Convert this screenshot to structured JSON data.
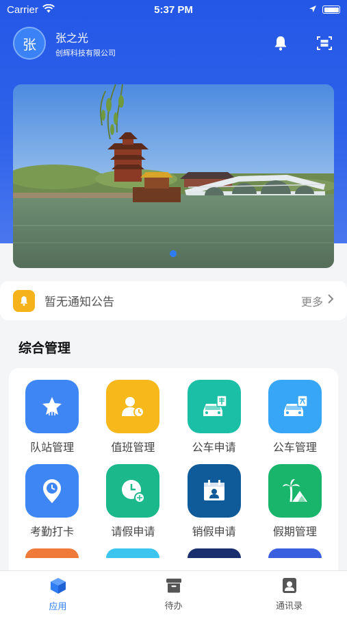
{
  "status": {
    "carrier": "Carrier",
    "time": "5:37 PM"
  },
  "user": {
    "avatar_text": "张",
    "name": "张之光",
    "company": "创辉科技有限公司"
  },
  "header_icons": [
    "bell-icon",
    "scan-icon"
  ],
  "banner": {
    "slide_count": 1,
    "active_slide": 1
  },
  "notice": {
    "text": "暂无通知公告",
    "more": "更多"
  },
  "section": {
    "title": "综合管理"
  },
  "grid": {
    "items": [
      {
        "label": "队站管理",
        "icon": "star-icon",
        "color": "#3f86f5"
      },
      {
        "label": "值班管理",
        "icon": "duty-person-icon",
        "color": "#f7b81b"
      },
      {
        "label": "公车申请",
        "icon": "car-apply-icon",
        "color": "#1bbfa6"
      },
      {
        "label": "公车管理",
        "icon": "car-manage-icon",
        "color": "#38a6f6"
      },
      {
        "label": "考勤打卡",
        "icon": "location-clock-icon",
        "color": "#3f86f5"
      },
      {
        "label": "请假申请",
        "icon": "clock-leave-icon",
        "color": "#1bb88c"
      },
      {
        "label": "销假申请",
        "icon": "calendar-person-icon",
        "color": "#0f5b9a"
      },
      {
        "label": "假期管理",
        "icon": "palm-tree-icon",
        "color": "#19b56b"
      }
    ],
    "partial_row_colors": [
      "#f07a3a",
      "#3cc6ef",
      "#1a2f6e",
      "#3a60e0"
    ]
  },
  "tabs": [
    {
      "label": "应用",
      "icon": "cube-icon",
      "active": true
    },
    {
      "label": "待办",
      "icon": "archive-icon",
      "active": false
    },
    {
      "label": "通讯录",
      "icon": "contact-icon",
      "active": false
    }
  ],
  "colors": {
    "primary": "#2f7df6",
    "header": "#2457e6"
  }
}
